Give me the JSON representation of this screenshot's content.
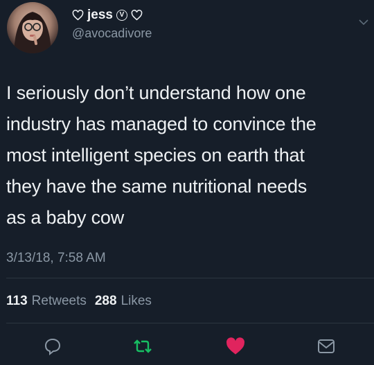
{
  "author": {
    "display_name": "jess",
    "verified_mark": "V",
    "handle": "@avocadivore"
  },
  "tweet": {
    "lines": [
      "I seriously don’t understand how one",
      "industry has managed to convince the",
      "most intelligent species on earth that",
      "they have the same nutritional needs",
      "as a baby cow"
    ],
    "timestamp": "3/13/18, 7:58 AM"
  },
  "stats": {
    "retweets_count": "113",
    "retweets_label": "Retweets",
    "likes_count": "288",
    "likes_label": "Likes"
  },
  "actions": [
    "reply-icon",
    "retweet-icon",
    "like-icon",
    "message-icon"
  ],
  "colors": {
    "background": "#161e29",
    "text": "#eef1f3",
    "secondary_text": "#8b98a5",
    "retweet": "#17bf63",
    "like": "#e0245e"
  }
}
